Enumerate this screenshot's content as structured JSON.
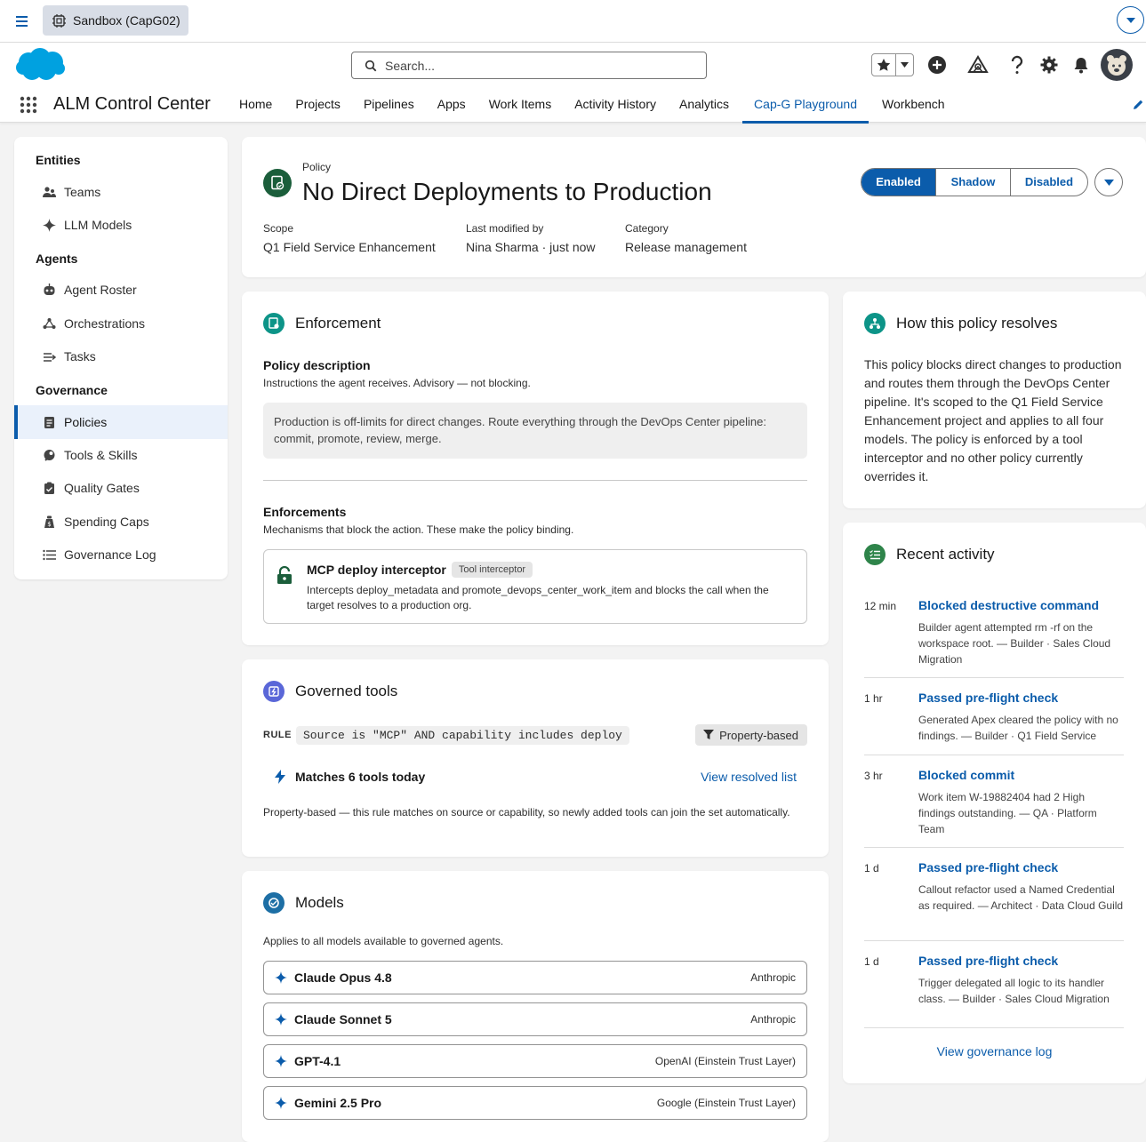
{
  "sandbox": {
    "label": "Sandbox (CapG02)"
  },
  "search": {
    "placeholder": "Search..."
  },
  "app": {
    "name": "ALM Control Center",
    "tabs": [
      "Home",
      "Projects",
      "Pipelines",
      "Apps",
      "Work Items",
      "Activity History",
      "Analytics",
      "Cap-G Playground",
      "Workbench"
    ],
    "active_tab": "Cap-G Playground"
  },
  "sidebar": {
    "sections": [
      {
        "title": "Entities",
        "items": [
          {
            "label": "Teams",
            "icon": "team-icon"
          },
          {
            "label": "LLM Models",
            "icon": "sparkle-icon"
          }
        ]
      },
      {
        "title": "Agents",
        "items": [
          {
            "label": "Agent Roster",
            "icon": "agent-icon"
          },
          {
            "label": "Orchestrations",
            "icon": "orchestration-icon"
          },
          {
            "label": "Tasks",
            "icon": "tasks-icon"
          }
        ]
      },
      {
        "title": "Governance",
        "items": [
          {
            "label": "Policies",
            "icon": "policy-icon"
          },
          {
            "label": "Tools & Skills",
            "icon": "tools-icon"
          },
          {
            "label": "Quality Gates",
            "icon": "gate-icon"
          },
          {
            "label": "Spending Caps",
            "icon": "money-icon"
          },
          {
            "label": "Governance Log",
            "icon": "list-icon"
          }
        ]
      }
    ],
    "active": "Policies"
  },
  "policy": {
    "kicker": "Policy",
    "title": "No Direct Deployments to Production",
    "meta": [
      {
        "key": "Scope",
        "value": "Q1 Field Service Enhancement"
      },
      {
        "key": "Last modified by",
        "value": "Nina Sharma · just now"
      },
      {
        "key": "Category",
        "value": "Release management"
      }
    ],
    "states": [
      "Enabled",
      "Shadow",
      "Disabled"
    ],
    "active_state": "Enabled"
  },
  "enforcement": {
    "heading": "Enforcement",
    "desc_title": "Policy description",
    "desc_sub": "Instructions the agent receives. Advisory — not blocking.",
    "desc_text": "Production is off-limits for direct changes. Route everything through the DevOps Center pipeline: commit, promote, review, merge.",
    "enf_title": "Enforcements",
    "enf_sub": "Mechanisms that block the action. These make the policy binding.",
    "interceptor": {
      "name": "MCP deploy interceptor",
      "badge": "Tool interceptor",
      "text": "Intercepts deploy_metadata and promote_devops_center_work_item and blocks the call when the target resolves to a production org."
    }
  },
  "tools": {
    "heading": "Governed tools",
    "rule_label": "RULE",
    "rule_code": "Source is \"MCP\" AND capability includes deploy",
    "rule_badge": "Property-based",
    "matches": "Matches 6 tools today",
    "view_link": "View resolved list",
    "note": "Property-based — this rule matches on source or capability, so newly added tools can join the set automatically."
  },
  "models": {
    "heading": "Models",
    "sub": "Applies to all models available to governed agents.",
    "items": [
      {
        "name": "Claude Opus 4.8",
        "vendor": "Anthropic"
      },
      {
        "name": "Claude Sonnet 5",
        "vendor": "Anthropic"
      },
      {
        "name": "GPT-4.1",
        "vendor": "OpenAI (Einstein Trust Layer)"
      },
      {
        "name": "Gemini 2.5 Pro",
        "vendor": "Google (Einstein Trust Layer)"
      }
    ]
  },
  "resolve": {
    "heading": "How this policy resolves",
    "text": "This policy blocks direct changes to production and routes them through the DevOps Center pipeline. It's scoped to the Q1 Field Service Enhancement project and applies to all four models. The policy is enforced by a tool interceptor and no other policy currently overrides it."
  },
  "activity": {
    "heading": "Recent activity",
    "items": [
      {
        "time": "12 min",
        "title": "Blocked destructive command",
        "body": "Builder agent attempted rm -rf on the workspace root. — Builder · Sales Cloud Migration"
      },
      {
        "time": "1 hr",
        "title": "Passed pre-flight check",
        "body": "Generated Apex cleared the policy with no findings. — Builder · Q1 Field Service"
      },
      {
        "time": "3 hr",
        "title": "Blocked commit",
        "body": "Work item W-19882404 had 2 High findings outstanding. — QA · Platform Team"
      },
      {
        "time": "1 d",
        "title": "Passed pre-flight check",
        "body": "Callout refactor used a Named Credential as required. — Architect · Data Cloud Guild"
      },
      {
        "time": "1 d",
        "title": "Passed pre-flight check",
        "body": "Trigger delegated all logic to its handler class. — Builder · Sales Cloud Migration"
      }
    ],
    "footer_link": "View governance log"
  },
  "colors": {
    "brand": "#0b5cab",
    "policy_icon": "#1b5e3b",
    "enforcement_icon": "#0d9488",
    "tools_icon": "#5a67d8",
    "models_icon": "#1d6fa5",
    "activity_icon": "#2e844a"
  }
}
